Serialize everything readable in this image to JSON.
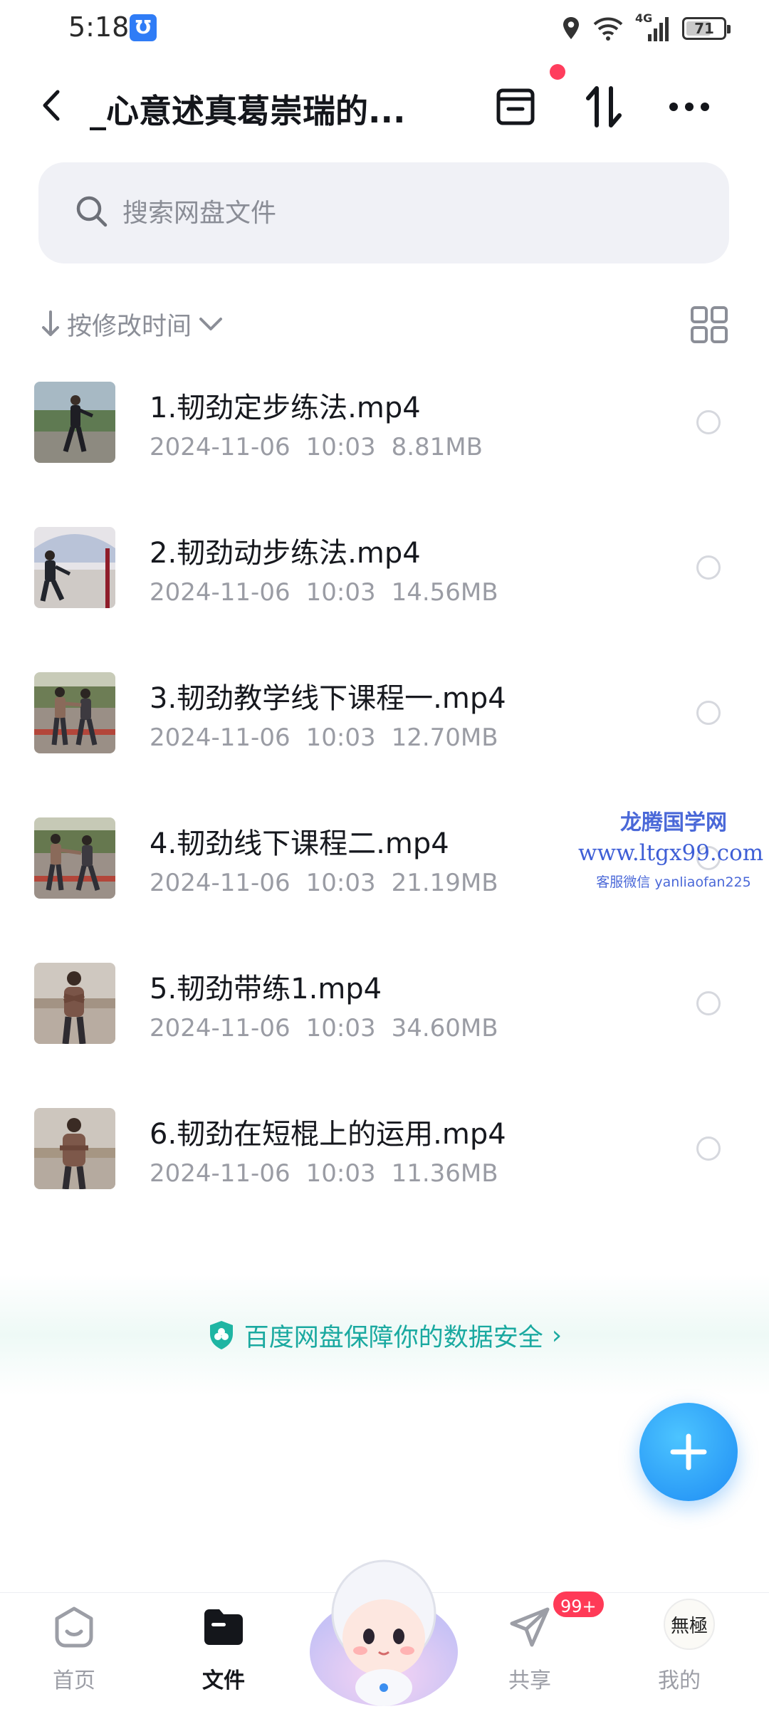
{
  "status_bar": {
    "time": "5:18",
    "app_badge": "℧",
    "network": "4G",
    "battery": "71",
    "battery_level": 0.71
  },
  "header": {
    "title": "_心意述真葛崇瑞的..."
  },
  "search": {
    "placeholder": "搜索网盘文件"
  },
  "sort": {
    "label": "按修改时间"
  },
  "files": [
    {
      "name": "1.韧劲定步练法.mp4",
      "date": "2024-11-06",
      "time": "10:03",
      "size": "8.81MB",
      "thumb": "thumb-1"
    },
    {
      "name": "2.韧劲动步练法.mp4",
      "date": "2024-11-06",
      "time": "10:03",
      "size": "14.56MB",
      "thumb": "thumb-2"
    },
    {
      "name": "3.韧劲教学线下课程一.mp4",
      "date": "2024-11-06",
      "time": "10:03",
      "size": "12.70MB",
      "thumb": "thumb-3"
    },
    {
      "name": "4.韧劲线下课程二.mp4",
      "date": "2024-11-06",
      "time": "10:03",
      "size": "21.19MB",
      "thumb": "thumb-4"
    },
    {
      "name": "5.韧劲带练1.mp4",
      "date": "2024-11-06",
      "time": "10:03",
      "size": "34.60MB",
      "thumb": "thumb-5"
    },
    {
      "name": "6.韧劲在短棍上的运用.mp4",
      "date": "2024-11-06",
      "time": "10:03",
      "size": "11.36MB",
      "thumb": "thumb-6"
    }
  ],
  "watermark": {
    "title": "龙腾国学网",
    "url": "www.ltgx99.com",
    "contact": "客服微信 yanliaofan225"
  },
  "security_banner": {
    "text": "百度网盘保障你的数据安全",
    "chevron": "›"
  },
  "nav": {
    "home": "首页",
    "files": "文件",
    "share": "共享",
    "share_badge": "99+",
    "mine": "我的",
    "avatar_text": "無極"
  },
  "colors": {
    "accent": "#1e8cf4",
    "security": "#1aa9a0",
    "badge": "#ff3a57",
    "watermark": "#4a68d8"
  }
}
